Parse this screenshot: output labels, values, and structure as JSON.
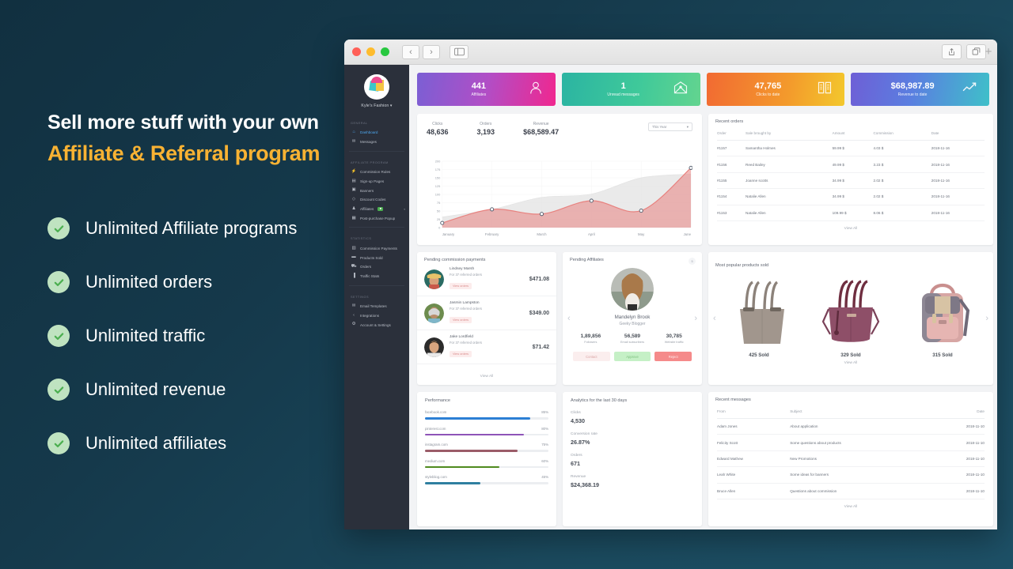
{
  "promo": {
    "line1": "Sell more stuff with your own",
    "line2": "Affiliate & Referral program",
    "features": [
      "Unlimited Affiliate programs",
      "Unlimited orders",
      "Unlimited traffic",
      "Unlimited revenue",
      "Unlimited affiliates"
    ],
    "accent_color": "#f8b233",
    "check_color": "#4caf50"
  },
  "window": {
    "back_label": "‹",
    "forward_label": "›",
    "plus_label": "+"
  },
  "sidebar": {
    "brand": "Kyle's Fashion ▾",
    "groups": [
      {
        "label": "GENERAL",
        "items": [
          {
            "label": "Dashboard",
            "icon": "home-icon",
            "glyph": "⌂",
            "active": true
          },
          {
            "label": "Messages",
            "icon": "chat-icon",
            "glyph": "✉",
            "active": false
          }
        ]
      },
      {
        "label": "AFFILIATE PROGRAM",
        "items": [
          {
            "label": "Commission Rules",
            "icon": "bolt-icon",
            "glyph": "⚡",
            "active": false
          },
          {
            "label": "Sign-up Pages",
            "icon": "page-icon",
            "glyph": "▤",
            "active": false
          },
          {
            "label": "Banners",
            "icon": "image-icon",
            "glyph": "▣",
            "active": false
          },
          {
            "label": "Discount Codes",
            "icon": "tag-icon",
            "glyph": "◇",
            "active": false
          },
          {
            "label": "Affiliates",
            "icon": "users-icon",
            "glyph": "♟",
            "active": false,
            "badge": "■",
            "caret": "▾"
          },
          {
            "label": "Post-purchase Popup",
            "icon": "window-icon",
            "glyph": "▦",
            "active": false
          }
        ]
      },
      {
        "label": "STATISTICS",
        "items": [
          {
            "label": "Commission Payments",
            "icon": "card-icon",
            "glyph": "▥",
            "active": false
          },
          {
            "label": "Products Sold",
            "icon": "bag-icon",
            "glyph": "▬",
            "active": false
          },
          {
            "label": "Orders",
            "icon": "cart-icon",
            "glyph": "⛟",
            "active": false
          },
          {
            "label": "Traffic Stats",
            "icon": "bars-icon",
            "glyph": "▐",
            "active": false
          }
        ]
      },
      {
        "label": "SETTINGS",
        "items": [
          {
            "label": "Email Templates",
            "icon": "mail-icon",
            "glyph": "✉",
            "active": false
          },
          {
            "label": "Integrations",
            "icon": "code-icon",
            "glyph": "‹",
            "active": false
          },
          {
            "label": "Account & Settings",
            "icon": "gear-icon",
            "glyph": "⚙",
            "active": false
          }
        ]
      }
    ]
  },
  "stats": [
    {
      "value": "441",
      "label": "Affiliates",
      "icon": "user-outline-icon"
    },
    {
      "value": "1",
      "label": "Unread messages",
      "icon": "mail-open-icon"
    },
    {
      "value": "47,765",
      "label": "Clicks to date",
      "icon": "book-icon"
    },
    {
      "value": "$68,987.89",
      "label": "Revenue to date",
      "icon": "trend-line-icon"
    }
  ],
  "chart_card": {
    "kpis": [
      {
        "label": "Clicks",
        "value": "48,636"
      },
      {
        "label": "Orders",
        "value": "3,193"
      },
      {
        "label": "Revenue",
        "value": "$68,589.47"
      }
    ],
    "select_value": "This Year",
    "select_caret": "▾"
  },
  "chart_data": {
    "type": "area",
    "title": "",
    "xlabel": "",
    "ylabel": "",
    "categories": [
      "January",
      "February",
      "March",
      "April",
      "May",
      "June"
    ],
    "ylim": [
      0,
      200
    ],
    "yticks": [
      0,
      25,
      50,
      75,
      100,
      125,
      150,
      175,
      200
    ],
    "grid": true,
    "legend": "none",
    "series": [
      {
        "name": "Revenue",
        "color": "#e8827f",
        "values": [
          14,
          55,
          41,
          81,
          51,
          180
        ],
        "markers": true
      },
      {
        "name": "Clicks",
        "color": "#e3e3e3",
        "values": [
          32,
          55,
          91,
          101,
          150,
          161
        ],
        "markers": false
      }
    ]
  },
  "recent_orders": {
    "title": "Recent orders",
    "columns": [
      "Order",
      "Sale brought by",
      "Amount",
      "Commission",
      "Date"
    ],
    "rows": [
      [
        "#1157",
        "Samantha Holmes",
        "59.99 $",
        "4.03 $",
        "2018-11-16"
      ],
      [
        "#1156",
        "Reed Bailey",
        "49.99 $",
        "3.23 $",
        "2018-11-16"
      ],
      [
        "#1155",
        "Joanne scotts",
        "34.99 $",
        "2.02 $",
        "2018-11-16"
      ],
      [
        "#1154",
        "Natalie Allen",
        "34.99 $",
        "2.02 $",
        "2018-11-16"
      ],
      [
        "#1153",
        "Natalie Allen",
        "109.99 $",
        "8.06 $",
        "2018-11-16"
      ]
    ],
    "view_all": "View All"
  },
  "pending_payments": {
    "title": "Pending commission payments",
    "items": [
      {
        "name": "Lindsey Marsh",
        "sub": "For 37 referred orders",
        "button": "View orders",
        "amount": "$471.08"
      },
      {
        "name": "Jasmin Lampston",
        "sub": "For 37 referred orders",
        "button": "View orders",
        "amount": "$349.00"
      },
      {
        "name": "Jake Lordfield",
        "sub": "For 37 referred orders",
        "button": "View orders",
        "amount": "$71.42"
      }
    ],
    "view_all": "View All"
  },
  "pending_affiliates": {
    "title": "Pending Affiliates",
    "badge": "5",
    "name": "Mandelyn Brook",
    "role": "Geeky Blogger",
    "stats": [
      {
        "value": "1,89,856",
        "label": "Followers"
      },
      {
        "value": "56,589",
        "label": "Email subscribers"
      },
      {
        "value": "30,785",
        "label": "Website traffic"
      }
    ],
    "buttons": [
      "Contact",
      "Approve",
      "Reject"
    ],
    "prev": "‹",
    "next": "›"
  },
  "popular_products": {
    "title": "Most popular products sold",
    "items": [
      {
        "sold": "425 Sold",
        "kind": "tote-bag",
        "color": "#9c9188"
      },
      {
        "sold": "329 Sold",
        "kind": "handbag",
        "color": "#8e5769"
      },
      {
        "sold": "315 Sold",
        "kind": "backpack",
        "color": "#d9a7a4"
      }
    ],
    "view_all": "View All",
    "prev": "‹",
    "next": "›"
  },
  "performance": {
    "title": "Performance",
    "rows": [
      {
        "site": "facebook.com",
        "pct": "85%",
        "value": 85,
        "color": "#2c7fd4"
      },
      {
        "site": "pinterest.com",
        "pct": "80%",
        "value": 80,
        "color": "#8e54b8"
      },
      {
        "site": "instagram.com",
        "pct": "75%",
        "value": 75,
        "color": "#9b5c68"
      },
      {
        "site": "medium.com",
        "pct": "60%",
        "value": 60,
        "color": "#4f8a1e"
      },
      {
        "site": "stylebliog.com",
        "pct": "45%",
        "value": 45,
        "color": "#2f7fa0"
      }
    ]
  },
  "analytics": {
    "title": "Analytics for the last 30 days",
    "rows": [
      {
        "label": "Clicks",
        "value": "4,530"
      },
      {
        "label": "Conversion rate",
        "value": "26.87%"
      },
      {
        "label": "Orders",
        "value": "671"
      },
      {
        "label": "Revenue",
        "value": "$24,368.19"
      }
    ]
  },
  "recent_messages": {
    "title": "Recent messages",
    "columns": [
      "From",
      "Subject",
      "Date"
    ],
    "rows": [
      [
        "Adam Jones",
        "About application",
        "2018-11-10"
      ],
      [
        "Felicity Scott",
        "Some questions about products",
        "2018-11-10"
      ],
      [
        "Edward Mathew",
        "New Promotions",
        "2018-11-10"
      ],
      [
        "Leah White",
        "Some ideas for banners",
        "2018-11-10"
      ],
      [
        "Bruce Allen",
        "Questions about commission",
        "2018-11-10"
      ]
    ],
    "view_all": "View All"
  }
}
